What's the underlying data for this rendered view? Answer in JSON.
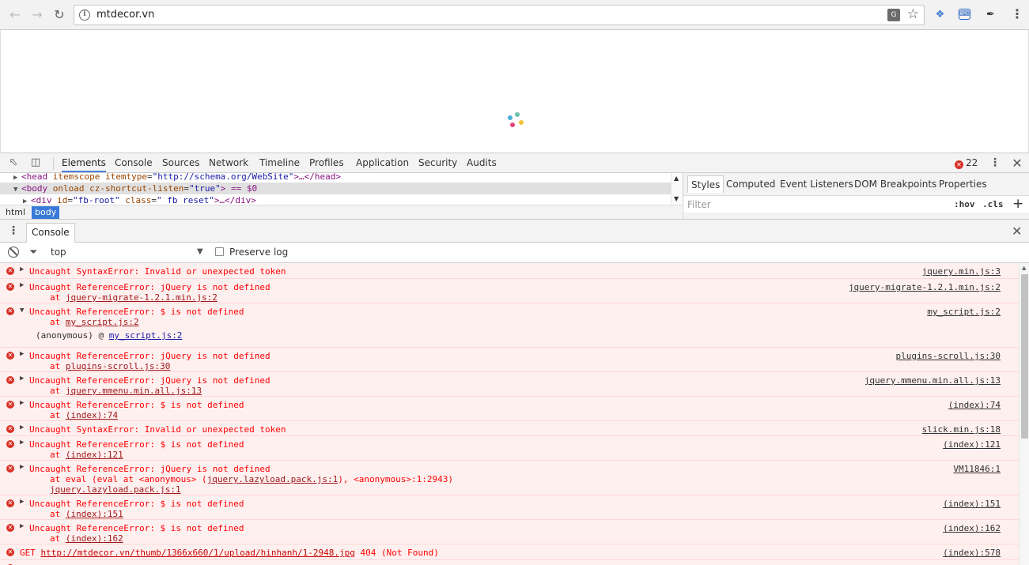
{
  "browser": {
    "url": "mtdecor.vn",
    "back_icon": "arrow-left-icon",
    "forward_icon": "arrow-right-icon",
    "reload_icon": "reload-icon",
    "spinner_colors": [
      "#6ec1a6",
      "#f3c13a",
      "#e0457b",
      "#4aaed6"
    ]
  },
  "devtools": {
    "tabs": [
      "Elements",
      "Console",
      "Sources",
      "Network",
      "Timeline",
      "Profiles",
      "Application",
      "Security",
      "Audits"
    ],
    "error_count": "22",
    "elements": {
      "line1": {
        "tag_open": "<head",
        "attr1": "itemscope",
        "attr2": "itemtype",
        "val2": "\"http://schema.org/WebSite\"",
        "rest": ">…</head>"
      },
      "line2": {
        "tag_open": "<body",
        "attr1": "onload",
        "attr2": "cz-shortcut-listen",
        "val2": "\"true\"",
        "rest": "> == $0"
      },
      "line3": {
        "tag_open": "<div",
        "attr1": "id",
        "val1": "\"fb-root\"",
        "attr2": "class",
        "val2": "\" fb_reset\"",
        "rest": ">…</div>"
      }
    },
    "breadcrumb": [
      "html",
      "body"
    ],
    "styles_tabs": [
      "Styles",
      "Computed",
      "Event Listeners",
      "DOM Breakpoints",
      "Properties"
    ],
    "filter_placeholder": "Filter",
    "hov": ":hov",
    "cls": ".cls",
    "plus": "+",
    "drawer_tab": "Console",
    "context": "top",
    "preserve_log": "Preserve log"
  },
  "console": {
    "messages": [
      {
        "text": "Uncaught SyntaxError: Invalid or unexpected token",
        "src": "jquery.min.js:3"
      },
      {
        "text": "Uncaught ReferenceError: jQuery is not defined",
        "at": "jquery-migrate-1.2.1.min.js:2",
        "src": "jquery-migrate-1.2.1.min.js:2"
      },
      {
        "text": "Uncaught ReferenceError: $ is not defined",
        "at": "my_script.js:2",
        "anon_label": "(anonymous) @",
        "anon_link": "my_script.js:2",
        "src": "my_script.js:2"
      },
      {
        "text": "Uncaught ReferenceError: jQuery is not defined",
        "at": "plugins-scroll.js:30",
        "src": "plugins-scroll.js:30"
      },
      {
        "text": "Uncaught ReferenceError: jQuery is not defined",
        "at": "jquery.mmenu.min.all.js:13",
        "src": "jquery.mmenu.min.all.js:13"
      },
      {
        "text": "Uncaught ReferenceError: $ is not defined",
        "at": "(index):74",
        "src": "(index):74"
      },
      {
        "text": "Uncaught SyntaxError: Invalid or unexpected token",
        "src": "slick.min.js:18"
      },
      {
        "text": "Uncaught ReferenceError: $ is not defined",
        "at": "(index):121",
        "src": "(index):121"
      },
      {
        "text": "Uncaught ReferenceError: jQuery is not defined",
        "eval_pre": "at eval (eval at <anonymous> (",
        "eval_link": "jquery.lazyload.pack.js:1",
        "eval_post": "), <anonymous>:1:2943)",
        "at": "jquery.lazyload.pack.js:1",
        "src": "VM11846:1"
      },
      {
        "text": "Uncaught ReferenceError: $ is not defined",
        "at": "(index):151",
        "src": "(index):151"
      },
      {
        "text": "Uncaught ReferenceError: $ is not defined",
        "at": "(index):162",
        "src": "(index):162"
      },
      {
        "get_prefix": "GET",
        "get_url": "http://mtdecor.vn/thumb/1366x660/1/upload/hinhanh/1-2948.jpg",
        "get_status": "404 (Not Found)",
        "src": "(index):578"
      }
    ]
  }
}
